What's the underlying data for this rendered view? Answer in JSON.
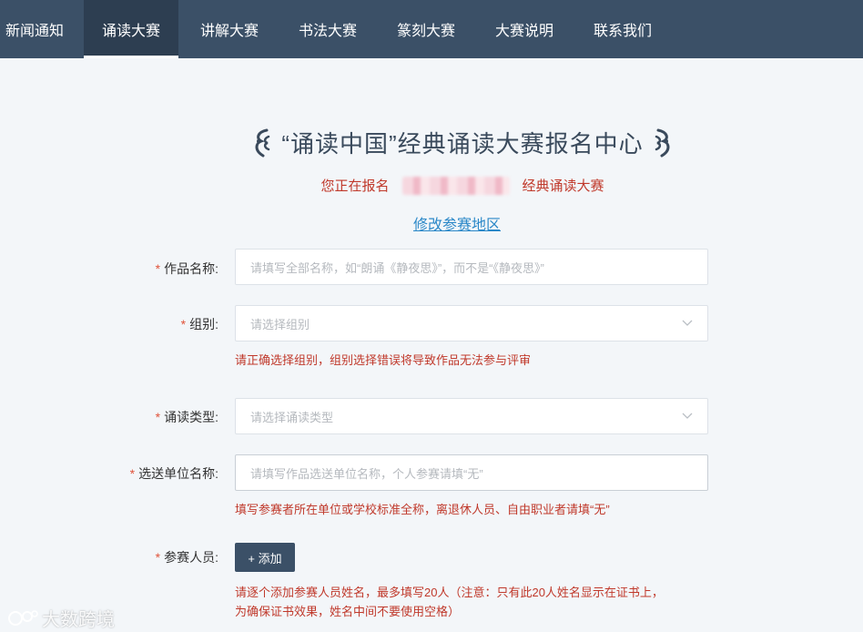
{
  "nav": {
    "items": [
      {
        "label": "新闻通知"
      },
      {
        "label": "诵读大赛"
      },
      {
        "label": "讲解大赛"
      },
      {
        "label": "书法大赛"
      },
      {
        "label": "篆刻大赛"
      },
      {
        "label": "大赛说明"
      },
      {
        "label": "联系我们"
      }
    ],
    "active_index": 1
  },
  "header": {
    "title": "“诵读中国”经典诵读大赛报名中心",
    "registering_prefix": "您正在报名",
    "registering_suffix": "经典诵读大赛",
    "change_region_link": "修改参赛地区"
  },
  "form": {
    "required_mark": "*",
    "work_name": {
      "label": "作品名称:",
      "placeholder": "请填写全部名称，如“朗诵《静夜思》”，而不是“《静夜思》”"
    },
    "group": {
      "label": "组别:",
      "placeholder": "请选择组别",
      "hint": "请正确选择组别，组别选择错误将导致作品无法参与评审"
    },
    "reading_type": {
      "label": "诵读类型:",
      "placeholder": "请选择诵读类型"
    },
    "unit_name": {
      "label": "选送单位名称:",
      "placeholder": "请填写作品选送单位名称，个人参赛请填“无”",
      "hint": "填写参赛者所在单位或学校标准全称，离退休人员、自由职业者请填“无”"
    },
    "participants": {
      "label": "参赛人员:",
      "add_button": "+ 添加",
      "hint_line1": "请逐个添加参赛人员姓名，最多填写20人（注意：只有此20人姓名显示在证书上，",
      "hint_line2": "为确保证书效果，姓名中间不要使用空格）"
    }
  },
  "watermark": {
    "text": "大数跨境"
  },
  "colors": {
    "nav_bg": "#3b5067",
    "nav_active_bg": "#2d3e51",
    "page_bg": "#f3f6f9",
    "alert_red": "#c0392b",
    "link_blue": "#2b88c8"
  }
}
